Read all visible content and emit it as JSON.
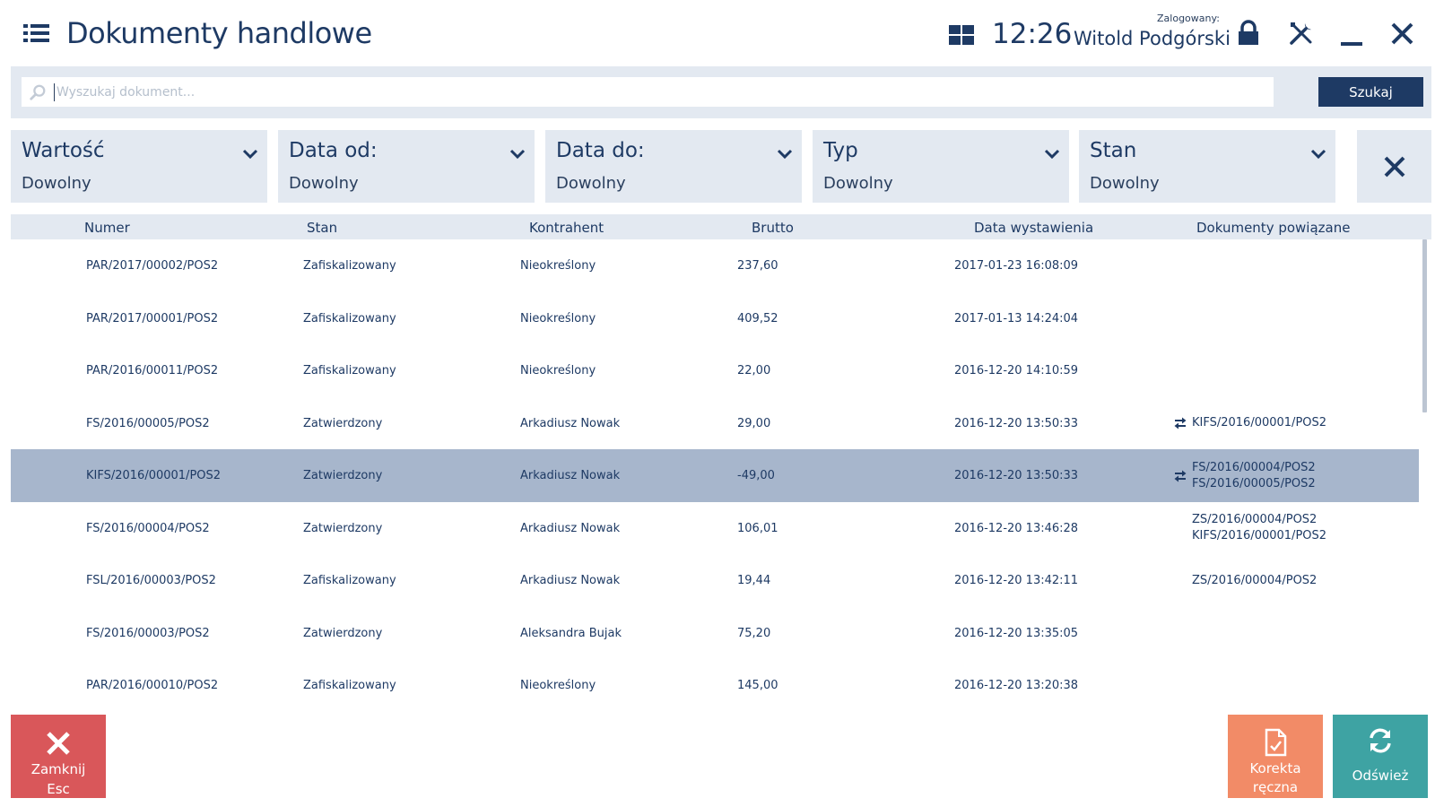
{
  "header": {
    "title": "Dokumenty handlowe",
    "time": "12:26",
    "logged_label": "Zalogowany:",
    "user_name": "Witold Podgórski"
  },
  "search": {
    "placeholder": "Wyszukaj dokument...",
    "value": "",
    "button_label": "Szukaj"
  },
  "filters": [
    {
      "label": "Wartość",
      "value": "Dowolny"
    },
    {
      "label": "Data od:",
      "value": "Dowolny"
    },
    {
      "label": "Data do:",
      "value": "Dowolny"
    },
    {
      "label": "Typ",
      "value": "Dowolny"
    },
    {
      "label": "Stan",
      "value": "Dowolny"
    }
  ],
  "table": {
    "columns": [
      "Numer",
      "Stan",
      "Kontrahent",
      "Brutto",
      "Data wystawienia",
      "Dokumenty powiązane"
    ],
    "rows": [
      {
        "numer": "PAR/2017/00002/POS2",
        "stan": "Zafiskalizowany",
        "kontrahent": "Nieokreślony",
        "brutto": "237,60",
        "data": "2017-01-23 16:08:09",
        "related": [],
        "related_icon": false,
        "selected": false
      },
      {
        "numer": "PAR/2017/00001/POS2",
        "stan": "Zafiskalizowany",
        "kontrahent": "Nieokreślony",
        "brutto": "409,52",
        "data": "2017-01-13 14:24:04",
        "related": [],
        "related_icon": false,
        "selected": false
      },
      {
        "numer": "PAR/2016/00011/POS2",
        "stan": "Zafiskalizowany",
        "kontrahent": "Nieokreślony",
        "brutto": "22,00",
        "data": "2016-12-20 14:10:59",
        "related": [],
        "related_icon": false,
        "selected": false
      },
      {
        "numer": "FS/2016/00005/POS2",
        "stan": "Zatwierdzony",
        "kontrahent": "Arkadiusz Nowak",
        "brutto": "29,00",
        "data": "2016-12-20 13:50:33",
        "related": [
          "KIFS/2016/00001/POS2"
        ],
        "related_icon": true,
        "selected": false
      },
      {
        "numer": "KIFS/2016/00001/POS2",
        "stan": "Zatwierdzony",
        "kontrahent": "Arkadiusz Nowak",
        "brutto": "-49,00",
        "data": "2016-12-20 13:50:33",
        "related": [
          "FS/2016/00004/POS2",
          "FS/2016/00005/POS2"
        ],
        "related_icon": true,
        "selected": true
      },
      {
        "numer": "FS/2016/00004/POS2",
        "stan": "Zatwierdzony",
        "kontrahent": "Arkadiusz Nowak",
        "brutto": "106,01",
        "data": "2016-12-20 13:46:28",
        "related": [
          "ZS/2016/00004/POS2",
          "KIFS/2016/00001/POS2"
        ],
        "related_icon": false,
        "selected": false
      },
      {
        "numer": "FSL/2016/00003/POS2",
        "stan": "Zafiskalizowany",
        "kontrahent": "Arkadiusz Nowak",
        "brutto": "19,44",
        "data": "2016-12-20 13:42:11",
        "related": [
          "ZS/2016/00004/POS2"
        ],
        "related_icon": false,
        "selected": false
      },
      {
        "numer": "FS/2016/00003/POS2",
        "stan": "Zatwierdzony",
        "kontrahent": "Aleksandra Bujak",
        "brutto": "75,20",
        "data": "2016-12-20 13:35:05",
        "related": [],
        "related_icon": false,
        "selected": false
      },
      {
        "numer": "PAR/2016/00010/POS2",
        "stan": "Zafiskalizowany",
        "kontrahent": "Nieokreślony",
        "brutto": "145,00",
        "data": "2016-12-20 13:20:38",
        "related": [],
        "related_icon": false,
        "selected": false
      }
    ]
  },
  "buttons": {
    "close_label": "Zamknij",
    "close_shortcut": "Esc",
    "correction_label_1": "Korekta",
    "correction_label_2": "ręczna",
    "refresh_label": "Odśwież"
  },
  "colors": {
    "primary": "#1e3a64",
    "panel": "#e3e9f1",
    "selected_row": "#a7b6cc",
    "close_button": "#d9575a",
    "correction_button": "#f28b67",
    "refresh_button": "#3ea3a3"
  },
  "icons": {
    "menu": "hamburger-icon",
    "layout": "grid-icon",
    "lock": "lock-icon",
    "tools": "tools-icon",
    "minimize": "minimize-icon",
    "close": "close-icon",
    "search": "search-icon",
    "related": "swap-arrows-icon",
    "refresh": "refresh-icon",
    "correction": "document-edit-icon"
  }
}
